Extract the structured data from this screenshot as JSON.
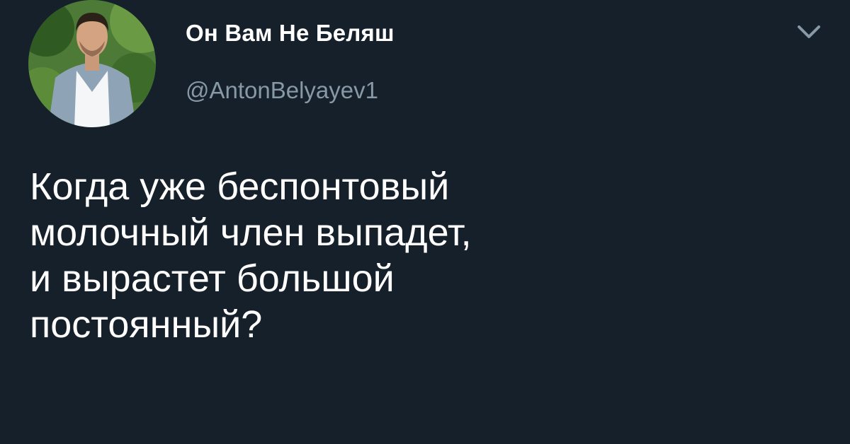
{
  "user": {
    "display_name": "Он Вам Не Беляш",
    "handle": "@AntonBelyayev1",
    "avatar": "profile-photo"
  },
  "menu": {
    "icon": "chevron-down-icon"
  },
  "tweet": {
    "lines": [
      "Когда уже беспонтовый",
      "молочный член выпадет,",
      "и вырастет большой",
      "постоянный?"
    ]
  },
  "colors": {
    "background": "#15202b",
    "text": "#ffffff",
    "secondary_text": "#8899a6"
  }
}
